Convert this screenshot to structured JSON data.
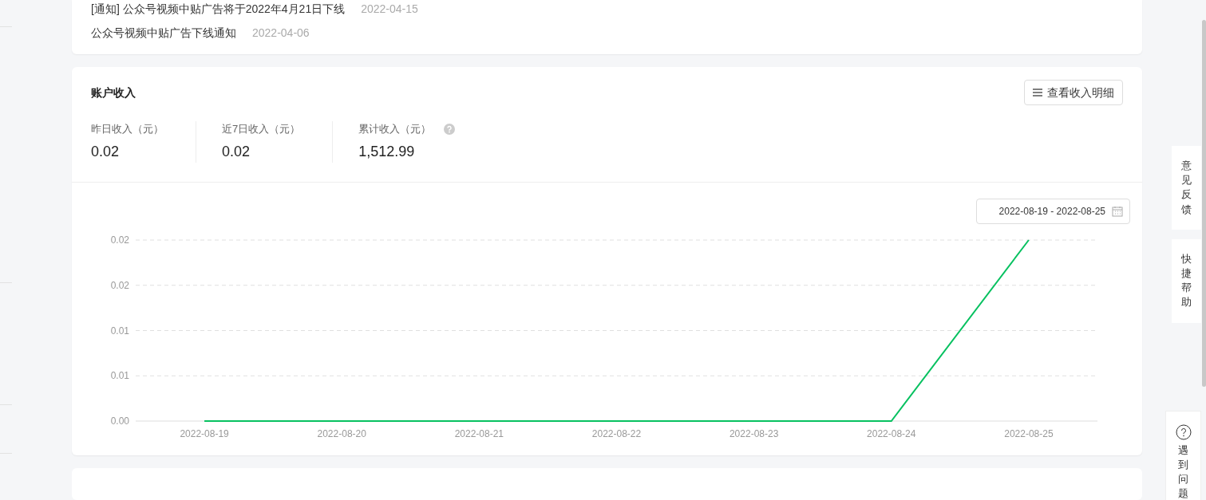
{
  "notices": [
    {
      "title": "[通知] 公众号视频中贴广告将于2022年4月21日下线",
      "date": "2022-04-15"
    },
    {
      "title": "公众号视频中贴广告下线通知",
      "date": "2022-04-06"
    }
  ],
  "income": {
    "title": "账户收入",
    "detail_button": "查看收入明细",
    "stats": [
      {
        "label": "昨日收入（元）",
        "value": "0.02",
        "help": false
      },
      {
        "label": "近7日收入（元）",
        "value": "0.02",
        "help": false
      },
      {
        "label": "累计收入（元）",
        "value": "1,512.99",
        "help": true
      }
    ],
    "date_range": "2022-08-19 - 2022-08-25",
    "chart_data": {
      "type": "line",
      "categories": [
        "2022-08-19",
        "2022-08-20",
        "2022-08-21",
        "2022-08-22",
        "2022-08-23",
        "2022-08-24",
        "2022-08-25"
      ],
      "series": [
        {
          "color": "#07c160",
          "values": [
            0,
            0,
            0,
            0,
            0,
            0,
            0.02
          ]
        }
      ],
      "grid": true,
      "ylim": [
        0,
        0.02
      ],
      "yticks": [
        {
          "value": 0,
          "label": "0.00"
        },
        {
          "value": 0.005,
          "label": "0.01"
        },
        {
          "value": 0.01,
          "label": "0.01"
        },
        {
          "value": 0.015,
          "label": "0.02"
        },
        {
          "value": 0.02,
          "label": "0.02"
        }
      ]
    }
  },
  "side_buttons": [
    {
      "kind": "text",
      "label": "意见反馈"
    },
    {
      "kind": "text",
      "label": "快捷帮助"
    },
    {
      "kind": "help",
      "label": "遇到问题"
    }
  ]
}
